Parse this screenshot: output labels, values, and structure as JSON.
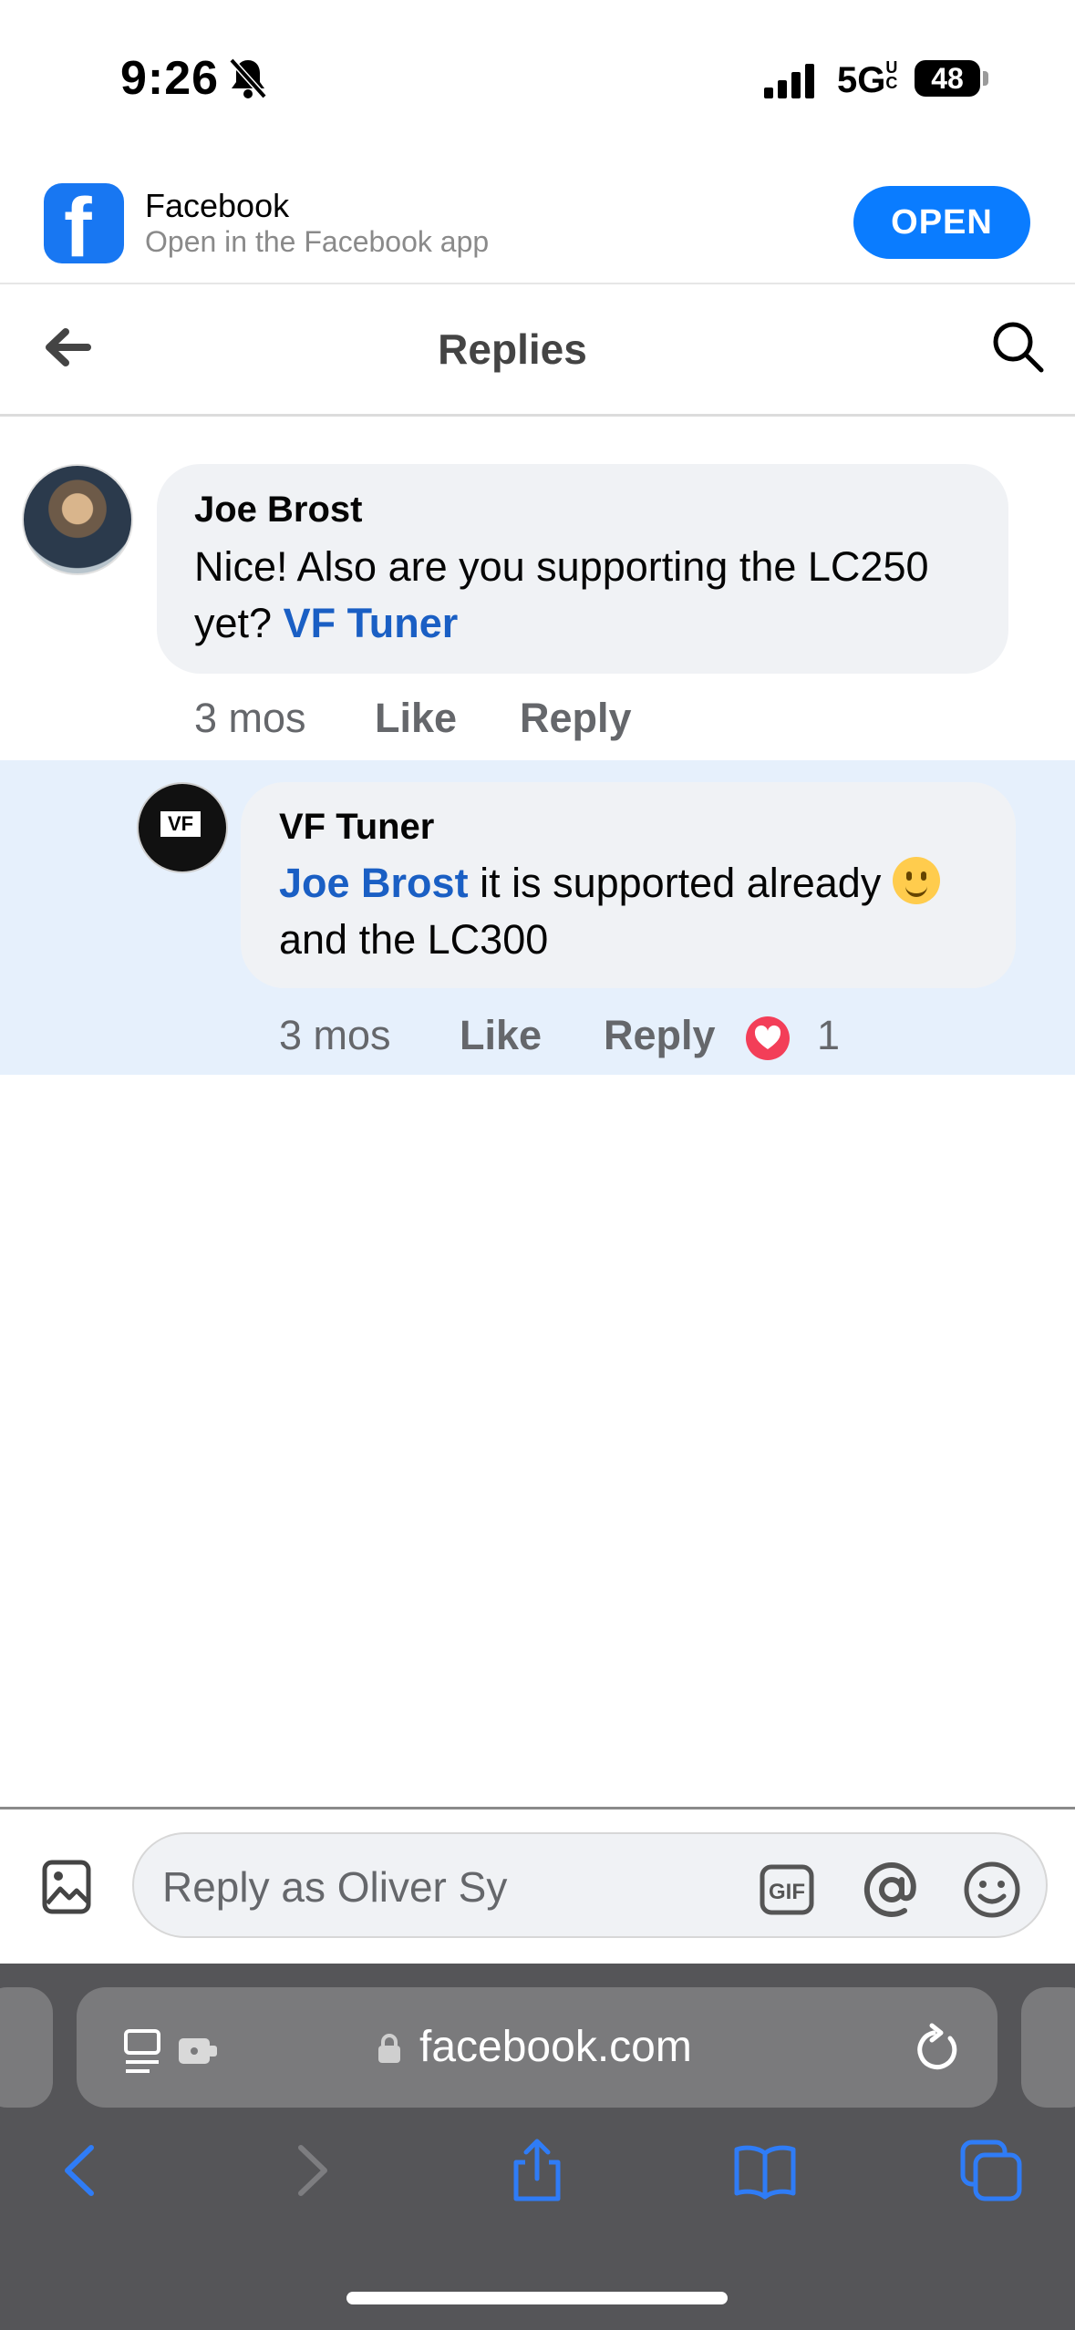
{
  "status_bar": {
    "time": "9:26",
    "network": "5G",
    "network_sup": "UC",
    "battery": "48"
  },
  "app_banner": {
    "app_name": "Facebook",
    "subtitle": "Open in the Facebook app",
    "open_label": "OPEN",
    "logo_letter": "f"
  },
  "header": {
    "title": "Replies"
  },
  "comments": [
    {
      "author": "Joe Brost",
      "text": "Nice! Also are you supporting the LC250 yet?",
      "mention": "VF Tuner",
      "time": "3 mos",
      "like_label": "Like",
      "reply_label": "Reply"
    },
    {
      "author": "VF Tuner",
      "avatar_text": "VF",
      "mention": "Joe Brost",
      "text": "it is supported already",
      "text_after": "and the LC300",
      "time": "3 mos",
      "like_label": "Like",
      "reply_label": "Reply",
      "reaction_count": "1"
    }
  ],
  "composer": {
    "placeholder": "Reply as Oliver Sy"
  },
  "browser": {
    "url": "facebook.com"
  },
  "colors": {
    "accent": "#0a7cff",
    "mention": "#1a5fc4",
    "highlight": "#e6f0fc",
    "heart": "#f33e58"
  },
  "icons": [
    "back-arrow-icon",
    "search-icon",
    "image-icon",
    "gif-icon",
    "at-icon",
    "emoji-icon",
    "lock-icon",
    "reader-icon",
    "extension-icon",
    "reload-icon",
    "back-chevron-icon",
    "forward-chevron-icon",
    "share-icon",
    "bookmarks-icon",
    "tabs-icon"
  ]
}
